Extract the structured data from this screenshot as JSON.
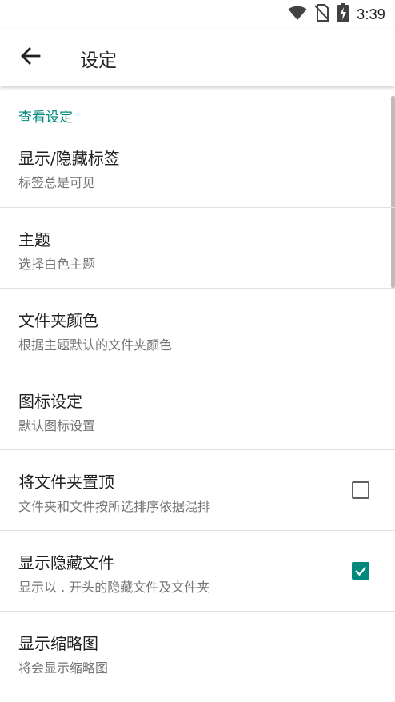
{
  "status_bar": {
    "time": "3:39",
    "icons": [
      "wifi-icon",
      "no-sim-icon",
      "battery-charging-icon"
    ]
  },
  "app_bar": {
    "back_icon": "arrow-back-icon",
    "title": "设定"
  },
  "section": {
    "header": "查看设定"
  },
  "settings": [
    {
      "title": "显示/隐藏标签",
      "summary": "标签总是可见"
    },
    {
      "title": "主题",
      "summary": "选择白色主题"
    },
    {
      "title": "文件夹颜色",
      "summary": "根据主题默认的文件夹颜色"
    },
    {
      "title": "图标设定",
      "summary": "默认图标设置"
    },
    {
      "title": "将文件夹置顶",
      "summary": "文件夹和文件按所选排序依据混排",
      "checkbox": false
    },
    {
      "title": "显示隐藏文件",
      "summary": "显示以 . 开头的隐藏文件及文件夹",
      "checkbox": true
    },
    {
      "title": "显示缩略图",
      "summary": "将会显示缩略图"
    }
  ],
  "colors": {
    "accent": "#00897b",
    "text_primary": "#212121",
    "text_secondary": "#757575",
    "divider": "#e0e0e0"
  }
}
